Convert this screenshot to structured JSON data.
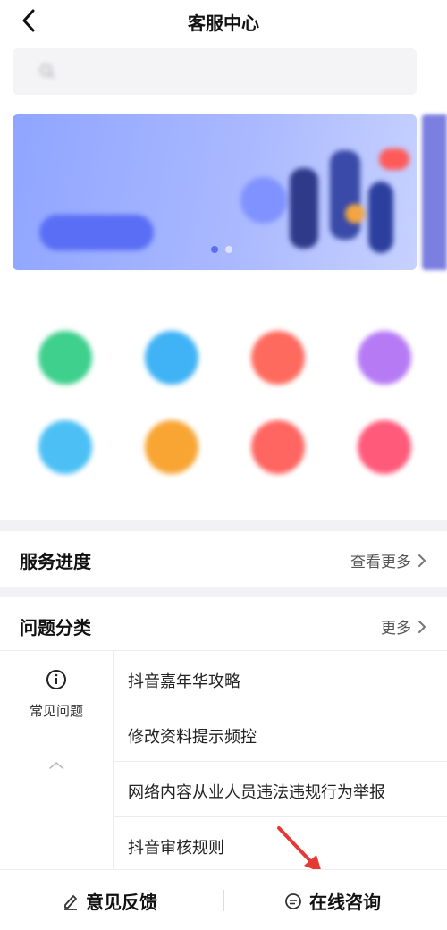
{
  "header": {
    "title": "客服中心",
    "back_icon": "chevron-left-icon"
  },
  "search": {
    "placeholder": ""
  },
  "banner": {
    "text": ""
  },
  "service_section": {
    "label": ""
  },
  "services": [
    {
      "label": "",
      "color": "#3ed08c"
    },
    {
      "label": "",
      "color": "#3fb3f5"
    },
    {
      "label": "",
      "color": "#ff6a5e"
    },
    {
      "label": "",
      "color": "#b67af5"
    },
    {
      "label": "",
      "color": "#4cc0f5"
    },
    {
      "label": "",
      "color": "#f8a534"
    },
    {
      "label": "",
      "color": "#ff6561"
    },
    {
      "label": "",
      "color": "#ff5a7a"
    }
  ],
  "progress": {
    "title": "服务进度",
    "more": "查看更多"
  },
  "category": {
    "title": "问题分类",
    "more": "更多",
    "tab": {
      "label": "常见问题",
      "icon": "info-circle-icon"
    },
    "questions": [
      "抖音嘉年华攻略",
      "修改资料提示频控",
      "网络内容从业人员违法违规行为举报",
      "抖音审核规则"
    ]
  },
  "bottom_bar": {
    "feedback": "意见反馈",
    "online": "在线咨询"
  },
  "colors": {
    "accent": "#5a6ef5",
    "divider": "#f2f2f4",
    "annotation_arrow": "#e53935"
  }
}
